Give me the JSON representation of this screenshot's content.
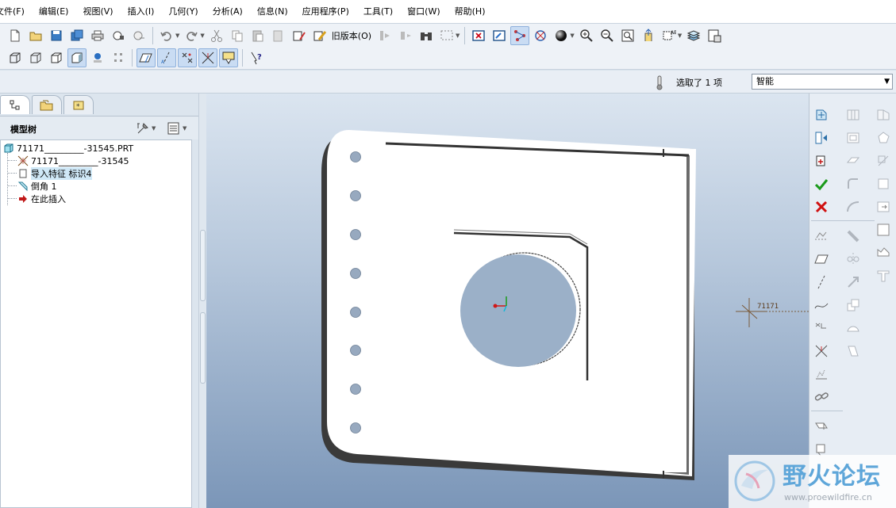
{
  "menu": [
    "文件(F)",
    "编辑(E)",
    "视图(V)",
    "插入(I)",
    "几何(Y)",
    "分析(A)",
    "信息(N)",
    "应用程序(P)",
    "工具(T)",
    "窗口(W)",
    "帮助(H)"
  ],
  "toolbar": {
    "old_version_label": "旧版本(O)"
  },
  "selection": {
    "status": "选取了 1 项",
    "filter_value": "智能"
  },
  "model_tree": {
    "title": "模型树",
    "items": [
      {
        "label": "71171_________-31545.PRT"
      },
      {
        "label": "71171_________-31545"
      },
      {
        "label": "导入特征 标识4"
      },
      {
        "label": "倒角 1"
      },
      {
        "label": "在此插入"
      }
    ]
  },
  "viewport": {
    "csys_label": "71171"
  },
  "colors": {
    "viewport_top": "#dbe5f0",
    "viewport_bottom": "#7b96b8",
    "part_face": "#ffffff",
    "part_shadow": "#3a3a3a",
    "accent_check": "#1a9a1a",
    "accent_cross": "#d01010"
  },
  "watermark": {
    "title": "野火论坛",
    "url": "www.proewildfire.cn"
  }
}
